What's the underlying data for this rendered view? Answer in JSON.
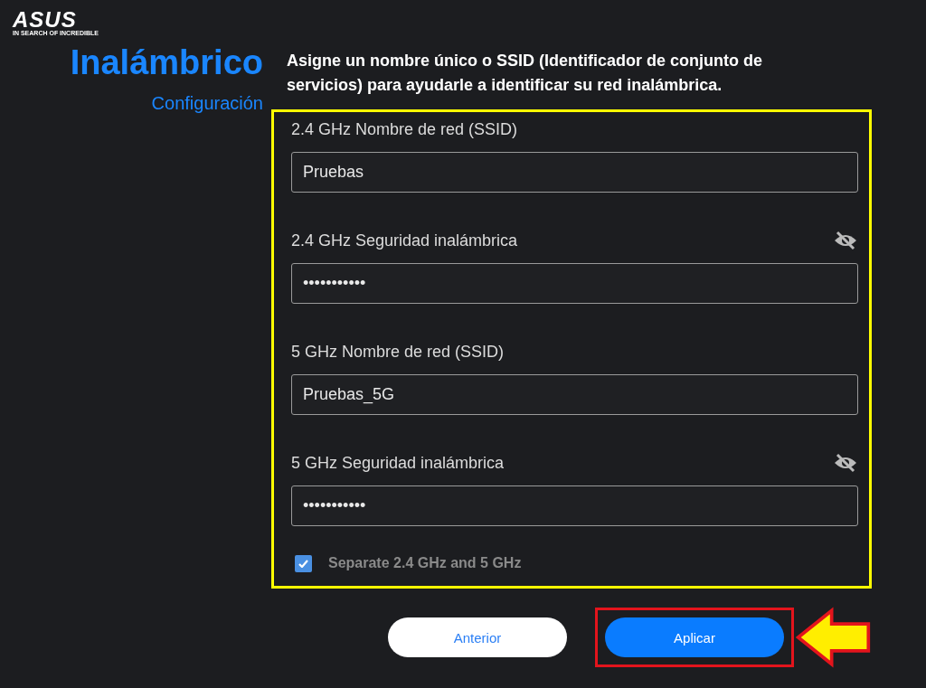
{
  "logo": {
    "brand": "ASUS",
    "tagline": "IN SEARCH OF INCREDIBLE"
  },
  "page": {
    "title": "Inalámbrico",
    "subtitle": "Configuración"
  },
  "intro": "Asigne un nombre único o SSID (Identificador de conjunto de servicios) para ayudarle a identificar su red inalámbrica.",
  "fields": [
    {
      "kind": "text",
      "label": "2.4 GHz Nombre de red (SSID)",
      "value": "Pruebas"
    },
    {
      "kind": "password",
      "label": "2.4 GHz Seguridad inalámbrica",
      "value": "•••••••••••"
    },
    {
      "kind": "text",
      "label": "5 GHz Nombre de red (SSID)",
      "value": "Pruebas_5G"
    },
    {
      "kind": "password",
      "label": "5 GHz Seguridad inalámbrica",
      "value": "•••••••••••"
    }
  ],
  "separate_bands": {
    "label": "Separate 2.4 GHz and 5 GHz",
    "checked": true
  },
  "buttons": [
    {
      "label": "Anterior",
      "kind": "secondary",
      "highlighted": false
    },
    {
      "label": "Aplicar",
      "kind": "primary",
      "highlighted": true
    }
  ]
}
